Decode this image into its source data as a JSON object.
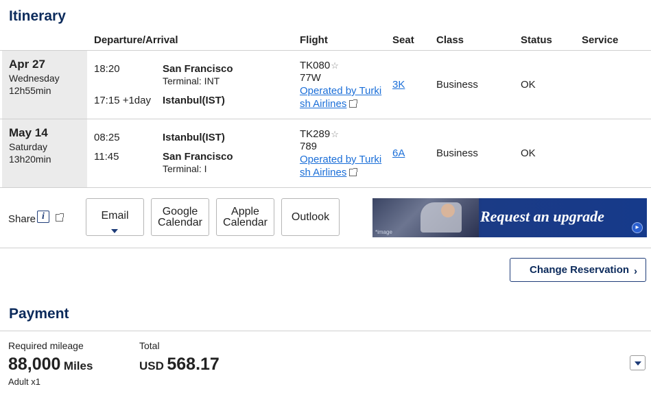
{
  "itinerary": {
    "title": "Itinerary",
    "columns": {
      "departure_arrival": "Departure/Arrival",
      "flight": "Flight",
      "seat": "Seat",
      "class": "Class",
      "status": "Status",
      "service": "Service"
    },
    "segments": [
      {
        "date": "Apr 27",
        "weekday": "Wednesday",
        "duration": "12h55min",
        "dep_time": "18:20",
        "dep_city": "San Francisco",
        "dep_terminal": "Terminal: INT",
        "arr_time": "17:15 +1day",
        "arr_city": "Istanbul(IST)",
        "flight_no": "TK080",
        "aircraft": "77W",
        "operated_line1": "Operated by Turki",
        "operated_line2": "sh Airlines",
        "seat": "3K",
        "class": "Business",
        "status": "OK"
      },
      {
        "date": "May 14",
        "weekday": "Saturday",
        "duration": "13h20min",
        "dep_time": "08:25",
        "dep_city": "Istanbul(IST)",
        "arr_time": "11:45",
        "arr_city": "San Francisco",
        "arr_terminal": "Terminal: I",
        "flight_no": "TK289",
        "aircraft": "789",
        "operated_line1": "Operated by Turki",
        "operated_line2": "sh Airlines",
        "seat": "6A",
        "class": "Business",
        "status": "OK"
      }
    ]
  },
  "share": {
    "label": "Share",
    "info_glyph": "i",
    "buttons": {
      "email": "Email",
      "google_line1": "Google",
      "google_line2": "Calendar",
      "apple_line1": "Apple",
      "apple_line2": "Calendar",
      "outlook": "Outlook"
    }
  },
  "banner": {
    "text": "Request an upgrade",
    "image_label": "*image"
  },
  "change_reservation": "Change Reservation",
  "payment": {
    "title": "Payment",
    "required_label": "Required mileage",
    "miles_value": "88,000",
    "miles_unit": "Miles",
    "passengers": "Adult x1",
    "total_label": "Total",
    "currency": "USD",
    "total_value": "568.17"
  },
  "colors": {
    "heading": "#0b2a5b",
    "link": "#1a6ed8",
    "day_cell_bg": "#ebebeb"
  }
}
